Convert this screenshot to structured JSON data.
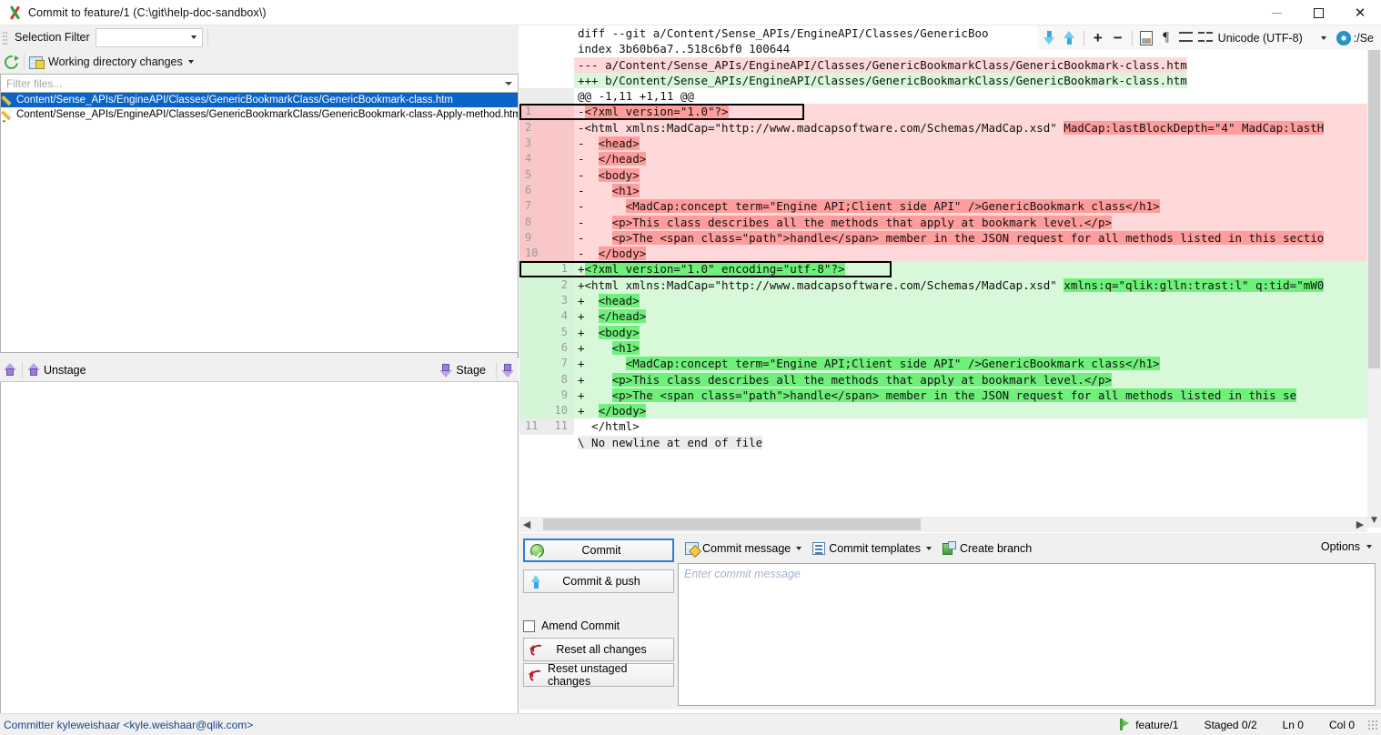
{
  "window": {
    "title": "Commit to feature/1 (C:\\git\\help-doc-sandbox\\)",
    "app_icon": "git-extensions-icon",
    "minimize_label": "–",
    "maximize_label": "□",
    "close_label": "✕"
  },
  "left_panel": {
    "selection_filter_label": "Selection Filter",
    "selection_filter_value": "",
    "refresh_icon": "refresh-icon",
    "working_dir_label": "Working directory changes",
    "filter_files_placeholder": "Filter files...",
    "files": [
      {
        "name": "Content/Sense_APIs/EngineAPI/Classes/GenericBookmarkClass/GenericBookmark-class.htm",
        "selected": true,
        "status_icon": "modified-pencil-icon"
      },
      {
        "name": "Content/Sense_APIs/EngineAPI/Classes/GenericBookmarkClass/GenericBookmark-class-Apply-method.htm",
        "selected": false,
        "status_icon": "modified-pencil-icon"
      }
    ],
    "unstage_label": "Unstage",
    "stage_label": "Stage"
  },
  "diff_toolbar": {
    "prev_change_icon": "arrow-down-icon",
    "next_change_icon": "arrow-up-icon",
    "increase_context_label": "+",
    "decrease_context_label": "−",
    "view_file_icon": "document-image-icon",
    "show_whitespace_icon": "pilcrow-icon",
    "two_pane_icon": "two-row-view-icon",
    "four_pane_icon": "four-pane-view-icon",
    "encoding_label": "Unicode (UTF-8)",
    "settings_icon": "gear-icon",
    "trailing_text": ":/Sе"
  },
  "diff": {
    "lines": [
      {
        "kind": "hdr",
        "old": "",
        "new": "",
        "text": "diff --git a/Content/Sense_APIs/EngineAPI/Classes/GenericBoo"
      },
      {
        "kind": "hdr",
        "old": "",
        "new": "",
        "text": "index 3b60b6a7..518c6bf0 100644"
      },
      {
        "kind": "hdr-minus",
        "old": "",
        "new": "",
        "text": "--- a/Content/Sense_APIs/EngineAPI/Classes/GenericBookmarkClass/GenericBookmark-class.htm"
      },
      {
        "kind": "hdr-plus",
        "old": "",
        "new": "",
        "text": "+++ b/Content/Sense_APIs/EngineAPI/Classes/GenericBookmarkClass/GenericBookmark-class.htm"
      },
      {
        "kind": "hunk",
        "old": "",
        "new": "",
        "text": "@@ -1,11 +1,11 @@"
      },
      {
        "kind": "del",
        "old": "1",
        "new": "",
        "focus": true,
        "pre": "-",
        "hl": "<?xml version=\"1.0\"?>",
        "post": ""
      },
      {
        "kind": "del",
        "old": "2",
        "new": "",
        "pre": "-",
        "plain": "<html xmlns:MadCap=\"http://www.madcapsoftware.com/Schemas/MadCap.xsd\" ",
        "hl": "MadCap:lastBlockDepth=\"4\" MadCap:lastH",
        "post": ""
      },
      {
        "kind": "del",
        "old": "3",
        "new": "",
        "pre": "-",
        "plain": "  ",
        "hl": "<head>",
        "post": ""
      },
      {
        "kind": "del",
        "old": "4",
        "new": "",
        "pre": "-",
        "plain": "  ",
        "hl": "</head>",
        "post": ""
      },
      {
        "kind": "del",
        "old": "5",
        "new": "",
        "pre": "-",
        "plain": "  ",
        "hl": "<body>",
        "post": ""
      },
      {
        "kind": "del",
        "old": "6",
        "new": "",
        "pre": "-",
        "plain": "    ",
        "hl": "<h1>",
        "post": ""
      },
      {
        "kind": "del",
        "old": "7",
        "new": "",
        "pre": "-",
        "plain": "      ",
        "hl": "<MadCap:concept term=\"Engine API;Client side API\" />GenericBookmark class</h1>",
        "post": ""
      },
      {
        "kind": "del",
        "old": "8",
        "new": "",
        "pre": "-",
        "plain": "    ",
        "hl": "<p>This class describes all the methods that apply at bookmark level.</p>",
        "post": ""
      },
      {
        "kind": "del",
        "old": "9",
        "new": "",
        "pre": "-",
        "plain": "    ",
        "hl": "<p>The <span class=\"path\">handle</span> member in the JSON request for all methods listed in this sectio",
        "post": ""
      },
      {
        "kind": "del",
        "old": "10",
        "new": "",
        "pre": "-",
        "plain": "  ",
        "hl": "</body>",
        "post": ""
      },
      {
        "kind": "add",
        "old": "",
        "new": "1",
        "focus": true,
        "pre": "+",
        "hl": "<?xml version=\"1.0\" encoding=\"utf-8\"?>",
        "post": ""
      },
      {
        "kind": "add",
        "old": "",
        "new": "2",
        "pre": "+",
        "plain": "<html xmlns:MadCap=\"http://www.madcapsoftware.com/Schemas/MadCap.xsd\" ",
        "hl": "xmlns:q=\"qlik:glln:trast:l\" q:tid=\"mW0",
        "post": ""
      },
      {
        "kind": "add",
        "old": "",
        "new": "3",
        "pre": "+",
        "plain": "  ",
        "hl": "<head>",
        "post": ""
      },
      {
        "kind": "add",
        "old": "",
        "new": "4",
        "pre": "+",
        "plain": "  ",
        "hl": "</head>",
        "post": ""
      },
      {
        "kind": "add",
        "old": "",
        "new": "5",
        "pre": "+",
        "plain": "  ",
        "hl": "<body>",
        "post": ""
      },
      {
        "kind": "add",
        "old": "",
        "new": "6",
        "pre": "+",
        "plain": "    ",
        "hl": "<h1>",
        "post": ""
      },
      {
        "kind": "add",
        "old": "",
        "new": "7",
        "pre": "+",
        "plain": "      ",
        "hl": "<MadCap:concept term=\"Engine API;Client side API\" />GenericBookmark class</h1>",
        "post": ""
      },
      {
        "kind": "add",
        "old": "",
        "new": "8",
        "pre": "+",
        "plain": "    ",
        "hl": "<p>This class describes all the methods that apply at bookmark level.</p>",
        "post": ""
      },
      {
        "kind": "add",
        "old": "",
        "new": "9",
        "pre": "+",
        "plain": "    ",
        "hl": "<p>The <span class=\"path\">handle</span> member in the JSON request for all methods listed in this se",
        "post": ""
      },
      {
        "kind": "add",
        "old": "",
        "new": "10",
        "pre": "+",
        "plain": "  ",
        "hl": "</body>",
        "post": ""
      },
      {
        "kind": "ctx",
        "old": "11",
        "new": "11",
        "pre": " ",
        "plain": " </html>",
        "hl": "",
        "post": ""
      },
      {
        "kind": "nonewline",
        "old": "",
        "new": "",
        "pre": "",
        "plain": "\\ No newline at end of file",
        "hl": "",
        "post": ""
      }
    ]
  },
  "commit_area": {
    "commit_label": "Commit",
    "commit_push_label": "Commit & push",
    "amend_label": "Amend Commit",
    "amend_checked": false,
    "reset_all_label": "Reset all changes",
    "reset_unstaged_label": "Reset unstaged changes",
    "commit_message_label": "Commit message",
    "commit_templates_label": "Commit templates",
    "create_branch_label": "Create branch",
    "options_label": "Options",
    "message_placeholder": "Enter commit message",
    "message_value": ""
  },
  "statusbar": {
    "committer": "Committer kyleweishaar <kyle.weishaar@qlik.com>",
    "branch": "feature/1",
    "staged": "Staged 0/2",
    "line": "Ln 0",
    "col": "Col 0"
  },
  "colors": {
    "selection_blue": "#0a64c8",
    "delete_bg": "#ffd9d9",
    "delete_hl": "#ff9d9d",
    "add_bg": "#d7f8d9",
    "add_hl": "#6ef07a",
    "link_blue": "#16468c"
  }
}
